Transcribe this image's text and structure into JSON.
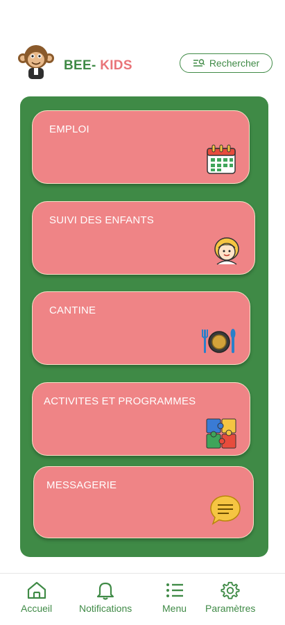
{
  "header": {
    "brand_part1": "BEE-",
    "brand_part2": "KIDS",
    "search_label": "Rechercher"
  },
  "cards": [
    {
      "label": "EMPLOI",
      "icon": "calendar-icon"
    },
    {
      "label": "SUIVI DES ENFANTS",
      "icon": "child-face-icon"
    },
    {
      "label": "CANTINE",
      "icon": "plate-cutlery-icon"
    },
    {
      "label": "ACTIVITES ET PROGRAMMES",
      "icon": "puzzle-icon"
    },
    {
      "label": "MESSAGERIE",
      "icon": "chat-bubble-icon"
    }
  ],
  "nav": [
    {
      "label": "Accueil",
      "icon": "home-icon"
    },
    {
      "label": "Notifications",
      "icon": "bell-icon"
    },
    {
      "label": "Menu",
      "icon": "list-icon"
    },
    {
      "label": "Paramètres",
      "icon": "gear-icon"
    }
  ],
  "colors": {
    "brand_green": "#3f8a46",
    "brand_pink": "#e97478",
    "card_pink": "#ef8486"
  }
}
